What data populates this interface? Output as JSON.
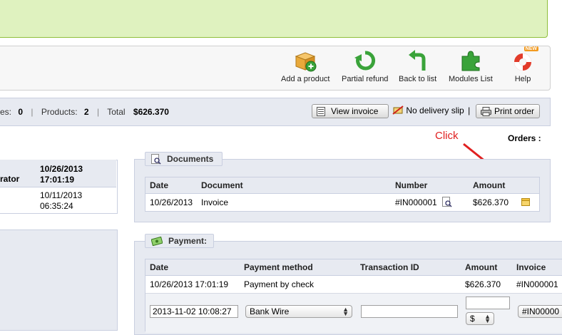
{
  "toolbar": {
    "add_product": "Add a product",
    "partial_refund": "Partial refund",
    "back_to_list": "Back to list",
    "modules_list": "Modules List",
    "help": "Help",
    "help_badge": "NEW"
  },
  "summary": {
    "prefix": "es:",
    "first_count": "0",
    "products_label": "Products:",
    "products_count": "2",
    "total_label": "Total",
    "total_value": "$626.370",
    "view_invoice": "View invoice",
    "no_delivery_slip": "No delivery slip",
    "pipe": "|",
    "print_order": "Print order"
  },
  "annotation": {
    "click": "Click"
  },
  "orders_label": "Orders :",
  "left_panel": {
    "header_left": "rator",
    "header_date": "10/26/2013",
    "header_time": "17:01:19",
    "row_date": "10/11/2013",
    "row_time": "06:35:24"
  },
  "documents": {
    "legend": "Documents",
    "columns": [
      "Date",
      "Document",
      "Number",
      "Amount"
    ],
    "row": {
      "date": "10/26/2013",
      "document": "Invoice",
      "number": "#IN000001",
      "amount": "$626.370"
    }
  },
  "payment": {
    "legend": "Payment:",
    "columns": [
      "Date",
      "Payment method",
      "Transaction ID",
      "Amount",
      "Invoice"
    ],
    "row": {
      "date": "10/26/2013 17:01:19",
      "method": "Payment by check",
      "amount": "$626.370",
      "invoice": "#IN000001"
    },
    "form": {
      "date_value": "2013-11-02 10:08:27",
      "method_value": "Bank Wire",
      "currency": "$",
      "invoice_value": "#IN00000"
    }
  },
  "colors": {
    "accent_green": "#dff2bf",
    "panel_blue": "#e7eaf1",
    "annotation_red": "#e02020"
  }
}
